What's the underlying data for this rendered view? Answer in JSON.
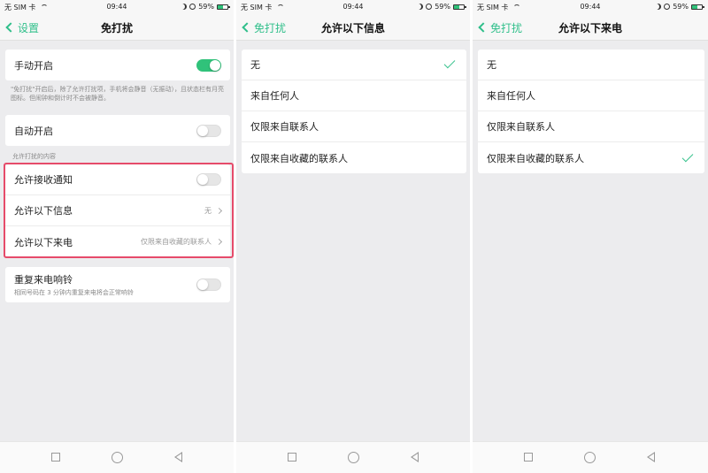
{
  "status": {
    "carrier": "无 SIM 卡",
    "time": "09:44",
    "battery": "59%"
  },
  "screen1": {
    "back_label": "设置",
    "title": "免打扰",
    "manual_label": "手动开启",
    "manual_on": true,
    "note": "\"免打扰\"开启后，除了允许打扰项，手机将会静音（无振动），且状态栏有月亮图标。但闹钟和倒计时不会被静音。",
    "auto_label": "自动开启",
    "section_label": "允许打扰的内容",
    "notify_label": "允许接收通知",
    "messages_label": "允许以下信息",
    "messages_value": "无",
    "calls_label": "允许以下来电",
    "calls_value": "仅限来自收藏的联系人",
    "repeat_label": "重复来电响铃",
    "repeat_sub": "相同号码在 3 分钟内重复来电将会正常响铃"
  },
  "screen2": {
    "back_label": "免打扰",
    "title": "允许以下信息",
    "options": [
      "无",
      "来自任何人",
      "仅限来自联系人",
      "仅限来自收藏的联系人"
    ],
    "selected_index": 0
  },
  "screen3": {
    "back_label": "免打扰",
    "title": "允许以下来电",
    "options": [
      "无",
      "来自任何人",
      "仅限来自联系人",
      "仅限来自收藏的联系人"
    ],
    "selected_index": 3
  },
  "colors": {
    "accent": "#30c27a",
    "highlight": "#e64b6a"
  }
}
